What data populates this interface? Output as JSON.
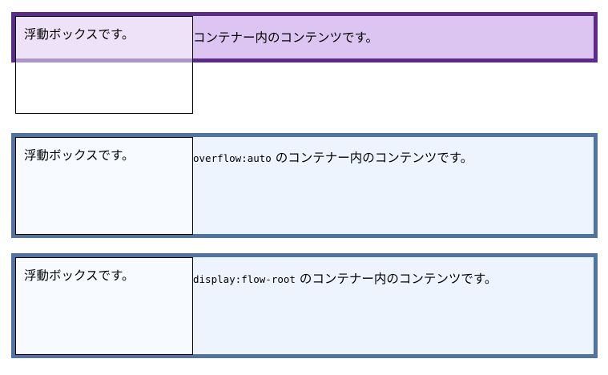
{
  "examples": [
    {
      "float_text": "浮動ボックスです。",
      "content_code": "",
      "content_text": "コンテナー内のコンテンツです。"
    },
    {
      "float_text": "浮動ボックスです。",
      "content_code": "overflow:auto",
      "content_text": " のコンテナー内のコンテンツです。"
    },
    {
      "float_text": "浮動ボックスです。",
      "content_code": "display:flow-root",
      "content_text": " のコンテナー内のコンテンツです。"
    }
  ],
  "colors": {
    "purple_border": "#5b2a8a",
    "purple_bg": "#dcc5f1",
    "blue_border": "#4f74a3",
    "blue_bg": "#eef4fe"
  }
}
